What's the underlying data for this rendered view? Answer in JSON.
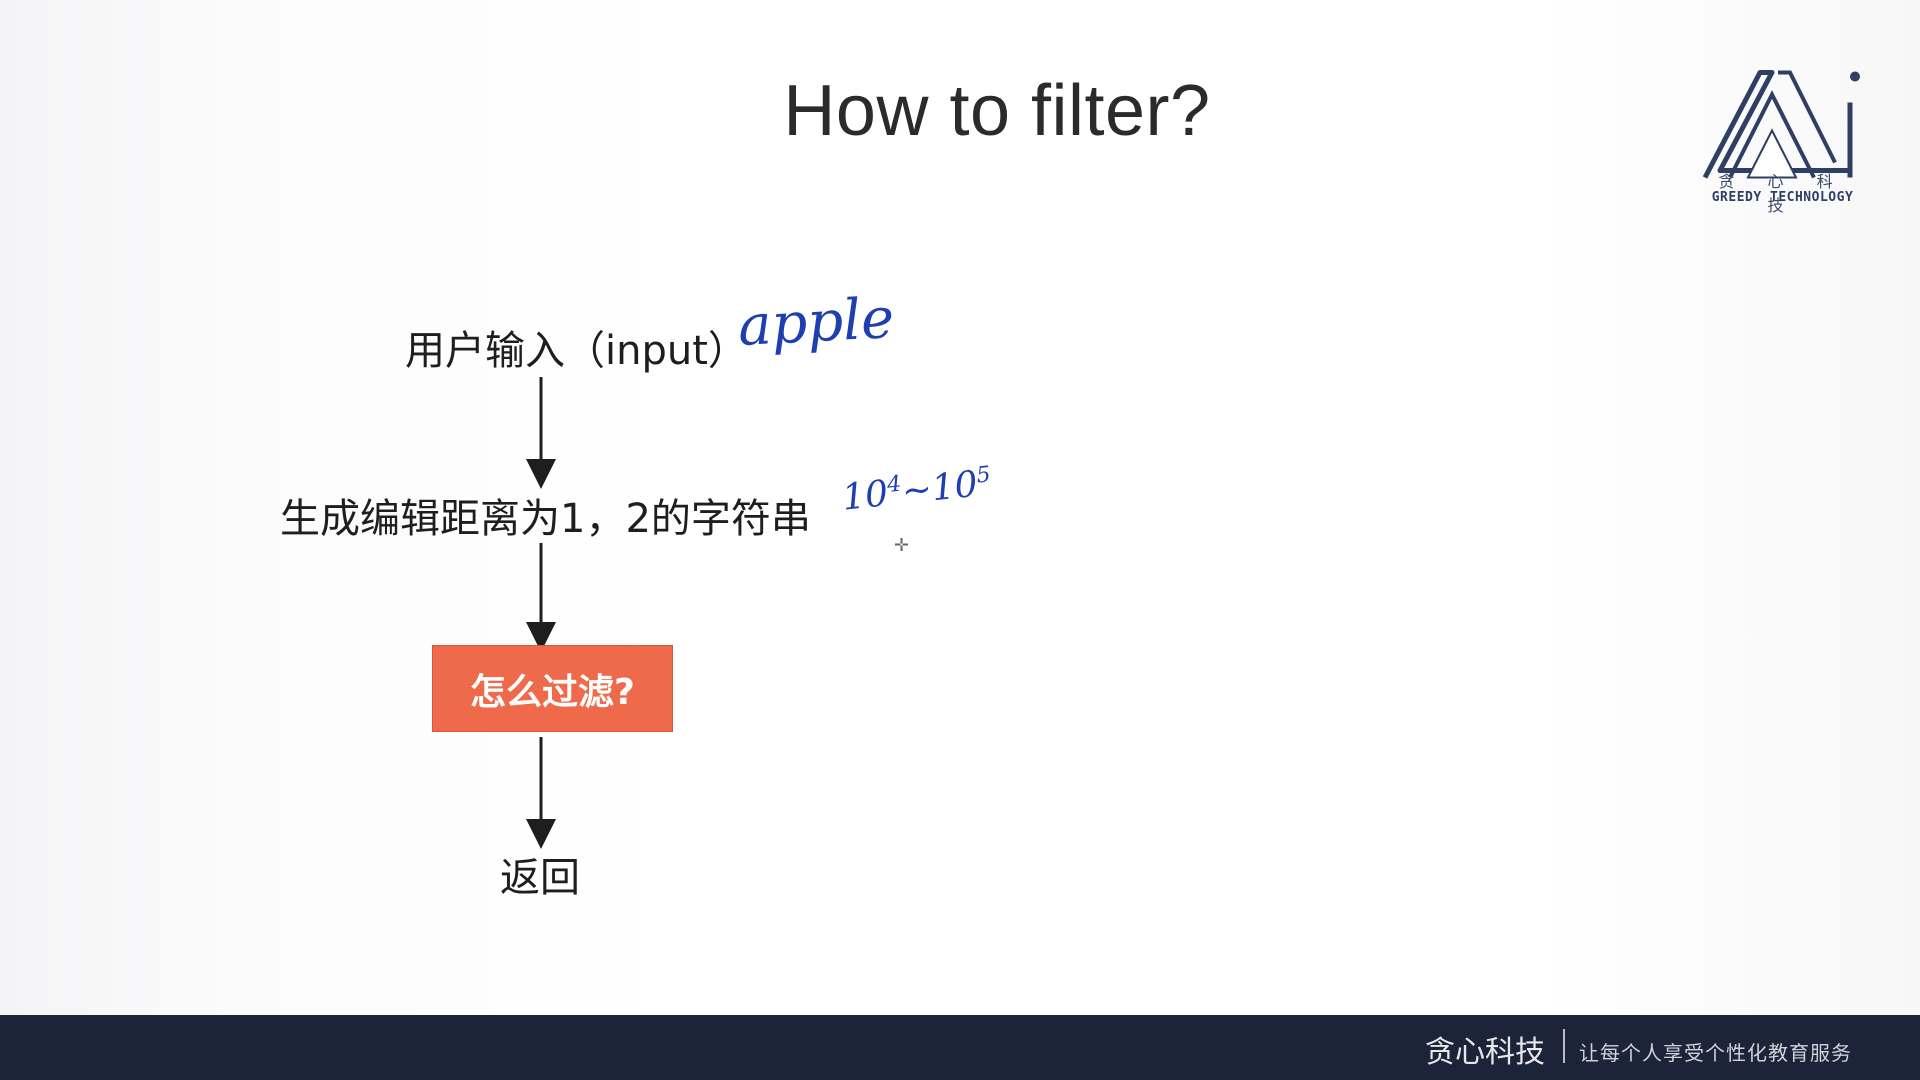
{
  "slide": {
    "title": "How to filter?"
  },
  "flowchart": {
    "nodes": {
      "input": "用户输入（input）",
      "generate": "生成编辑距离为1，2的字符串",
      "filter": "怎么过滤?",
      "return": "返回"
    }
  },
  "annotations": {
    "input_example": "apple",
    "range_base_low": "10",
    "range_exp_low": "4",
    "range_sep": "~",
    "range_base_high": "10",
    "range_exp_high": "5"
  },
  "logo": {
    "chinese": "贪 心 科 技",
    "english": "GREEDY TECHNOLOGY"
  },
  "footer": {
    "brand": "贪心科技",
    "slogan": "让每个人享受个性化教育服务"
  },
  "colors": {
    "filter_box": "#ef6a4b",
    "handwriting": "#1e3fb0",
    "footer_bg": "#1b2438"
  }
}
